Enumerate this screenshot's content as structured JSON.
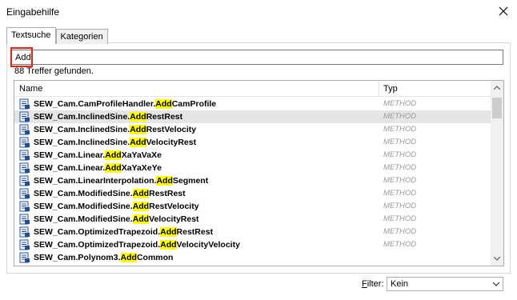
{
  "window": {
    "title": "Eingabehilfe"
  },
  "tabs": [
    {
      "label": "Textsuche",
      "active": true
    },
    {
      "label": "Kategorien",
      "active": false
    }
  ],
  "search": {
    "value": "Add",
    "placeholder": ""
  },
  "results": {
    "count_text": "88 Treffer gefunden."
  },
  "columns": {
    "name": "Name",
    "type": "Typ"
  },
  "rows": [
    {
      "prefix": "SEW_Cam.CamProfileHandler.",
      "match": "Add",
      "suffix": "CamProfile",
      "type": "METHOD",
      "selected": false
    },
    {
      "prefix": "SEW_Cam.InclinedSine.",
      "match": "Add",
      "suffix": "RestRest",
      "type": "METHOD",
      "selected": true
    },
    {
      "prefix": "SEW_Cam.InclinedSine.",
      "match": "Add",
      "suffix": "RestVelocity",
      "type": "METHOD",
      "selected": false
    },
    {
      "prefix": "SEW_Cam.InclinedSine.",
      "match": "Add",
      "suffix": "VelocityRest",
      "type": "METHOD",
      "selected": false
    },
    {
      "prefix": "SEW_Cam.Linear.",
      "match": "Add",
      "suffix": "XaYaVaXe",
      "type": "METHOD",
      "selected": false
    },
    {
      "prefix": "SEW_Cam.Linear.",
      "match": "Add",
      "suffix": "XaYaXeYe",
      "type": "METHOD",
      "selected": false
    },
    {
      "prefix": "SEW_Cam.LinearInterpolation.",
      "match": "Add",
      "suffix": "Segment",
      "type": "METHOD",
      "selected": false
    },
    {
      "prefix": "SEW_Cam.ModifiedSine.",
      "match": "Add",
      "suffix": "RestRest",
      "type": "METHOD",
      "selected": false
    },
    {
      "prefix": "SEW_Cam.ModifiedSine.",
      "match": "Add",
      "suffix": "RestVelocity",
      "type": "METHOD",
      "selected": false
    },
    {
      "prefix": "SEW_Cam.ModifiedSine.",
      "match": "Add",
      "suffix": "VelocityRest",
      "type": "METHOD",
      "selected": false
    },
    {
      "prefix": "SEW_Cam.OptimizedTrapezoid.",
      "match": "Add",
      "suffix": "RestRest",
      "type": "METHOD",
      "selected": false
    },
    {
      "prefix": "SEW_Cam.OptimizedTrapezoid.",
      "match": "Add",
      "suffix": "VelocityVelocity",
      "type": "METHOD",
      "selected": false
    },
    {
      "prefix": "SEW_Cam.Polynom3.",
      "match": "Add",
      "suffix": "Common",
      "type": "",
      "selected": false
    }
  ],
  "filter": {
    "label_first": "F",
    "label_rest": "ilter:",
    "value": "Kein"
  },
  "colors": {
    "highlight": "#ffff00",
    "selected_row": "#e5e5e5",
    "search_outline": "#e2231a",
    "method_text": "#9a9a9a"
  },
  "icons": {
    "close": "close-icon",
    "row": "method-icon",
    "scroll_up": "chevron-up-icon",
    "scroll_down": "chevron-down-icon",
    "dropdown": "chevron-down-icon"
  }
}
